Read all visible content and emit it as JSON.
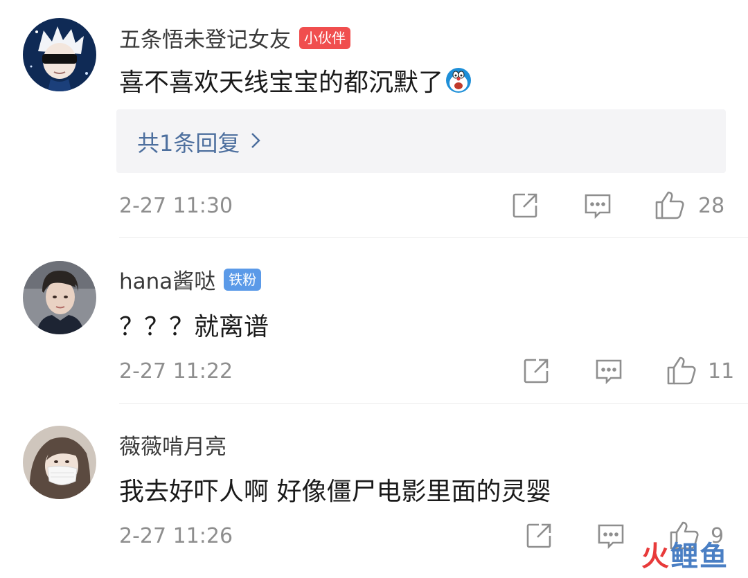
{
  "comments": [
    {
      "username": "五条悟未登记女友",
      "badge": "小伙伴",
      "badge_color": "#f04e4e",
      "text": "喜不喜欢天线宝宝的都沉默了",
      "emoji": "doraemon-shocked-emoji",
      "reply_link": "共1条回复",
      "time": "2-27 11:30",
      "likes": "28"
    },
    {
      "username": "hana酱哒",
      "badge": "铁粉",
      "badge_color": "#5b9ae8",
      "text": "？？？就离谱",
      "time": "2-27 11:22",
      "likes": "11"
    },
    {
      "username": "薇薇啃月亮",
      "text": "我去好吓人啊 好像僵尸电影里面的灵婴",
      "time": "2-27 11:26",
      "likes": "9"
    }
  ],
  "watermark": {
    "part1": "火",
    "part2": "鲤鱼"
  },
  "colors": {
    "reply_link": "#4d6f9e",
    "meta_gray": "#8e8e8e"
  }
}
